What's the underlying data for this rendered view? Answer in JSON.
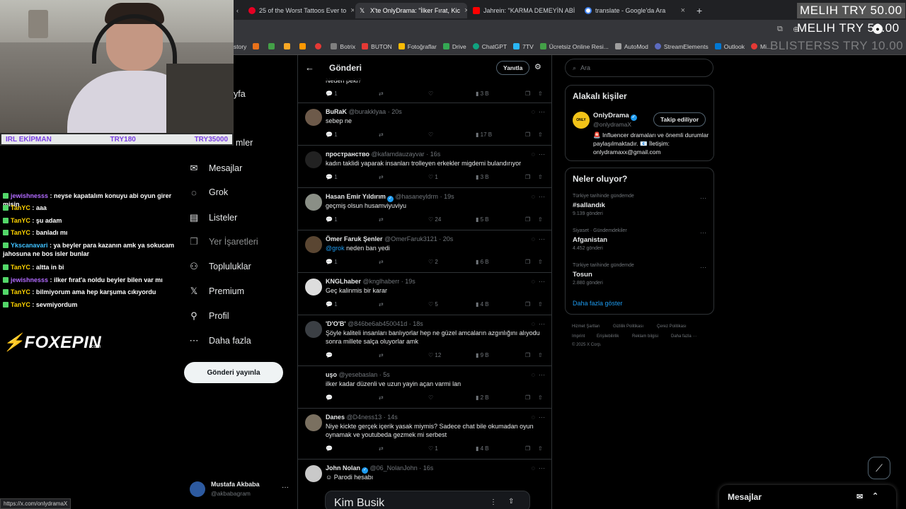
{
  "browser": {
    "tabs": [
      {
        "label": "25 of the Worst Tattoos Ever to",
        "color": "#e60023"
      },
      {
        "label": "X'te OnlyDrama: \"İlker Fırat, Kic",
        "color": "#ffffff"
      },
      {
        "label": "Jahrein: \"KARMA DEMEYİN ABİ",
        "color": "#ff0000"
      },
      {
        "label": "translate - Google'da Ara",
        "color": "#4285f4"
      }
    ],
    "new_tab": "+",
    "bookmarks": [
      {
        "label": "Botrix",
        "color": "#7f7f7f"
      },
      {
        "label": "BUTON",
        "color": "#e53935"
      },
      {
        "label": "Fotoğraflar",
        "color": "#fbbc05"
      },
      {
        "label": "Drive",
        "color": "#34a853"
      },
      {
        "label": "ChatGPT",
        "color": "#10a37f"
      },
      {
        "label": "7TV",
        "color": "#29b6f6"
      },
      {
        "label": "Ücretsiz Online Resi...",
        "color": "#43a047"
      },
      {
        "label": "AutoMod",
        "color": "#9e9e9e"
      },
      {
        "label": "StreamElements",
        "color": "#5c6bc0"
      },
      {
        "label": "Outlook",
        "color": "#0078d4"
      },
      {
        "label": "Mi...",
        "color": "#e53935"
      }
    ],
    "bookmark_history_label": "story",
    "status_url": "https://x.com/onlydramaX"
  },
  "overlay": {
    "donation_1": "MELIH  TRY 50.00",
    "donation_2": "MELIH  TRY 50.00",
    "donation_3": "BLISTERSS  TRY 10.00",
    "irl_label": "IRL EKİPMAN",
    "irl_goal_min": "TRY180",
    "irl_goal_max": "TRY35000",
    "logo": "FOXEPIN",
    "logo_sub": ".com"
  },
  "chat": [
    {
      "user": "jewishnesss",
      "msg": " : neyse kapatalım konuyu abi oyun girer misin",
      "style": "p"
    },
    {
      "user": "TanYC",
      "msg": " : aaa",
      "style": ""
    },
    {
      "user": "TanYC",
      "msg": " : şu adam",
      "style": ""
    },
    {
      "user": "TanYC",
      "msg": " : banladı mı",
      "style": ""
    },
    {
      "user": "Ykscanavari",
      "msg": " : ya beyler para kazanın amk ya sokucam jahosuna ne bos isler bunlar",
      "style": "c"
    },
    {
      "user": "TanYC",
      "msg": " : altta in bi",
      "style": ""
    },
    {
      "user": "jewishnesss",
      "msg": " : ilker fırat'a noldu beyler bilen var mı",
      "style": "p"
    },
    {
      "user": "TanYC",
      "msg": " : bilmiyorum ama hep karşuma cıkıyordu",
      "style": ""
    },
    {
      "user": "TanYC",
      "msg": " : sevmiyordum",
      "style": ""
    }
  ],
  "nav": {
    "home_partial": "yfa",
    "lists_partial": "mler",
    "messages": "Mesajlar",
    "grok": "Grok",
    "lists": "Listeler",
    "bookmarks": "Yer İşaretleri",
    "communities": "Topluluklar",
    "premium": "Premium",
    "profile": "Profil",
    "more": "Daha fazla",
    "post_button": "Gönderi yayınla",
    "account_name": "Mustafa Akbaba",
    "account_handle": "@akbabagram"
  },
  "feed": {
    "title": "Gönderi",
    "reply_button": "Yanıtla",
    "top_partial_text": "Neden peki?",
    "top_partial_views": "3 B",
    "top_partial_replies": "1",
    "tweets": [
      {
        "name": "BuRaK",
        "handle": "@burakklyaa",
        "time": "20s",
        "text": "sebep ne",
        "replies": "1",
        "retweets": "",
        "likes": "",
        "views": "17 B",
        "avatar": "#6d5a4a",
        "verified": false
      },
      {
        "name": "пространство",
        "handle": "@kafamdauzayvar",
        "time": "16s",
        "text": "kadın taklidi yaparak insanları trolleyen erkekler migdemi bulandırıyor",
        "replies": "1",
        "retweets": "",
        "likes": "1",
        "views": "3 B",
        "avatar": "#222222",
        "verified": false
      },
      {
        "name": "Hasan Emir Yıldırım",
        "handle": "@hasaneyldrm",
        "time": "19s",
        "text": "geçmiş olsun husamviyuviyu",
        "replies": "1",
        "retweets": "",
        "likes": "24",
        "views": "5 B",
        "avatar": "#8a8f86",
        "verified": true
      },
      {
        "name": "Ömer Faruk Şenler",
        "handle": "@OmerFaruk3121",
        "time": "20s",
        "text": "neden ban yedi",
        "mention": "@grok",
        "replies": "1",
        "retweets": "",
        "likes": "2",
        "views": "6 B",
        "avatar": "#5a4632",
        "verified": false
      },
      {
        "name": "KNGLhaber",
        "handle": "@knglhaberr",
        "time": "19s",
        "text": "Geç kalinmis bir karar",
        "replies": "1",
        "retweets": "",
        "likes": "5",
        "views": "4 B",
        "avatar": "#dddddd",
        "verified": false
      },
      {
        "name": "'D'O'B'",
        "handle": "@846be6ab450041d",
        "time": "18s",
        "text": "Şöyle kaliteli insanları banlıyorlar hep ne güzel amcaların azgınlığını alıyodu sonra millete salça oluyorlar amk",
        "replies": "",
        "retweets": "",
        "likes": "12",
        "views": "9 B",
        "avatar": "#3b3f44",
        "verified": false
      },
      {
        "name": "uşo",
        "handle": "@yesebaslan",
        "time": "5s",
        "text": "ilker kadar düzenli ve uzun yayin açan varmi lan",
        "replies": "",
        "retweets": "",
        "likes": "",
        "views": "2 B",
        "avatar": "#000000",
        "verified": false
      },
      {
        "name": "Danes",
        "handle": "@D4ness13",
        "time": "14s",
        "text": "Niye kickte gerçek içerik yasak miymis? Sadece chat bile okumadan oyun oynamak ve youtubeda gezmek mi serbest",
        "replies": "",
        "retweets": "",
        "likes": "1",
        "views": "4 B",
        "avatar": "#7a7060",
        "verified": false
      },
      {
        "name": "John Nolan",
        "handle": "@06_NolanJohn",
        "time": "16s",
        "text": "Parodi hesabı",
        "replies": "",
        "retweets": "",
        "likes": "",
        "views": "",
        "avatar": "#c9c9c9",
        "verified": true
      }
    ],
    "embedded_card_title": "Kim Busik"
  },
  "sidebar": {
    "search_placeholder": "Ara",
    "related_title": "Alakalı kişiler",
    "related_name": "OnlyDrama",
    "related_handle": "@onlydramaX",
    "related_bio": "🚨 Influencer dramaları ve önemli durumlar paylaşılmaktadır. 📧 İletişim: onlydramaxx@gmail.com",
    "follow_button": "Takip ediliyor",
    "trends_title": "Neler oluyor?",
    "trends": [
      {
        "category": "Türkiye tarihinde gündemde",
        "name": "#sallandık",
        "count": "9.139 gönderi"
      },
      {
        "category": "Siyaset · Gündemdekiler",
        "name": "Afganistan",
        "count": "4.452 gönderi"
      },
      {
        "category": "Türkiye tarihinde gündemde",
        "name": "Tosun",
        "count": "2.880 gönderi"
      }
    ],
    "show_more": "Daha fazla göster",
    "footer": [
      "Hizmet Şartları",
      "Gizlilik Politikası",
      "Çerez Politikası",
      "Imprint",
      "Erişilebilirlik",
      "Reklam bilgisi",
      "Daha fazla ···",
      "© 2025 X Corp."
    ]
  },
  "dm_bar": {
    "label": "Mesajlar"
  }
}
